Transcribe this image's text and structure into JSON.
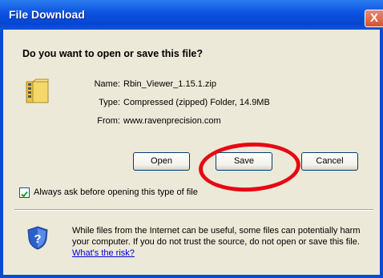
{
  "window": {
    "title": "File Download",
    "close_glyph": "X"
  },
  "dialog": {
    "question": "Do you want to open or save this file?",
    "name_label": "Name:",
    "name_value": "Rbin_Viewer_1.15.1.zip",
    "type_label": "Type:",
    "type_value": "Compressed (zipped) Folder, 14.9MB",
    "from_label": "From:",
    "from_value": "www.ravenprecision.com",
    "buttons": {
      "open": "Open",
      "save": "Save",
      "cancel": "Cancel"
    },
    "checkbox_label": "Always ask before opening this type of file",
    "checkbox_checked": true,
    "warning_text": "While files from the Internet can be useful, some files can potentially harm your computer. If you do not trust the source, do not open or save this file.",
    "warning_link": "What's the risk?"
  },
  "icons": {
    "file": "zip-folder-icon",
    "security": "shield-question-icon"
  },
  "colors": {
    "titlebar": "#0a52df",
    "dialog_bg": "#ece9d8",
    "close_button": "#d5532f",
    "highlight_annotation": "#e50914",
    "link": "#0000cc"
  }
}
